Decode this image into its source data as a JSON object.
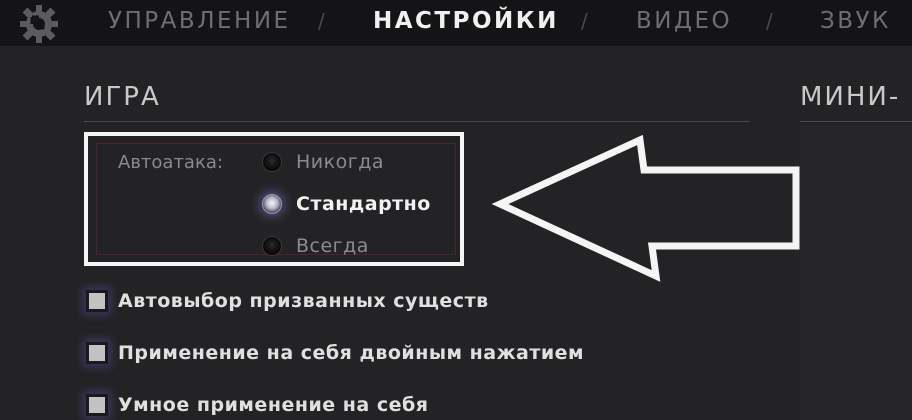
{
  "nav": {
    "tabs": [
      {
        "label": "УПРАВЛЕНИЕ",
        "active": false
      },
      {
        "label": "НАСТРОЙКИ",
        "active": true
      },
      {
        "label": "ВИДЕО",
        "active": false
      },
      {
        "label": "ЗВУК",
        "active": false
      }
    ],
    "separator": "/"
  },
  "sections": {
    "game": {
      "title": "ИГРА"
    },
    "minimap": {
      "title": "МИНИ-"
    }
  },
  "autoattack": {
    "label": "Автоатака:",
    "options": [
      {
        "label": "Никогда",
        "selected": false
      },
      {
        "label": "Стандартно",
        "selected": true
      },
      {
        "label": "Всегда",
        "selected": false
      }
    ]
  },
  "checkboxes": [
    {
      "label": "Автовыбор призванных существ",
      "checked": false
    },
    {
      "label": "Применение на себя двойным нажатием",
      "checked": false
    },
    {
      "label": "Умное применение на себя",
      "checked": false
    }
  ],
  "icons": {
    "settings": "gear-icon",
    "annotation": "arrow-left-outline"
  },
  "colors": {
    "background": "#232325",
    "topbar": "#141416",
    "active_tab": "#f0f0f0",
    "inactive_tab": "#6f6f72",
    "highlight": "#f5f5f5",
    "selected_glow": "#786ec8"
  }
}
